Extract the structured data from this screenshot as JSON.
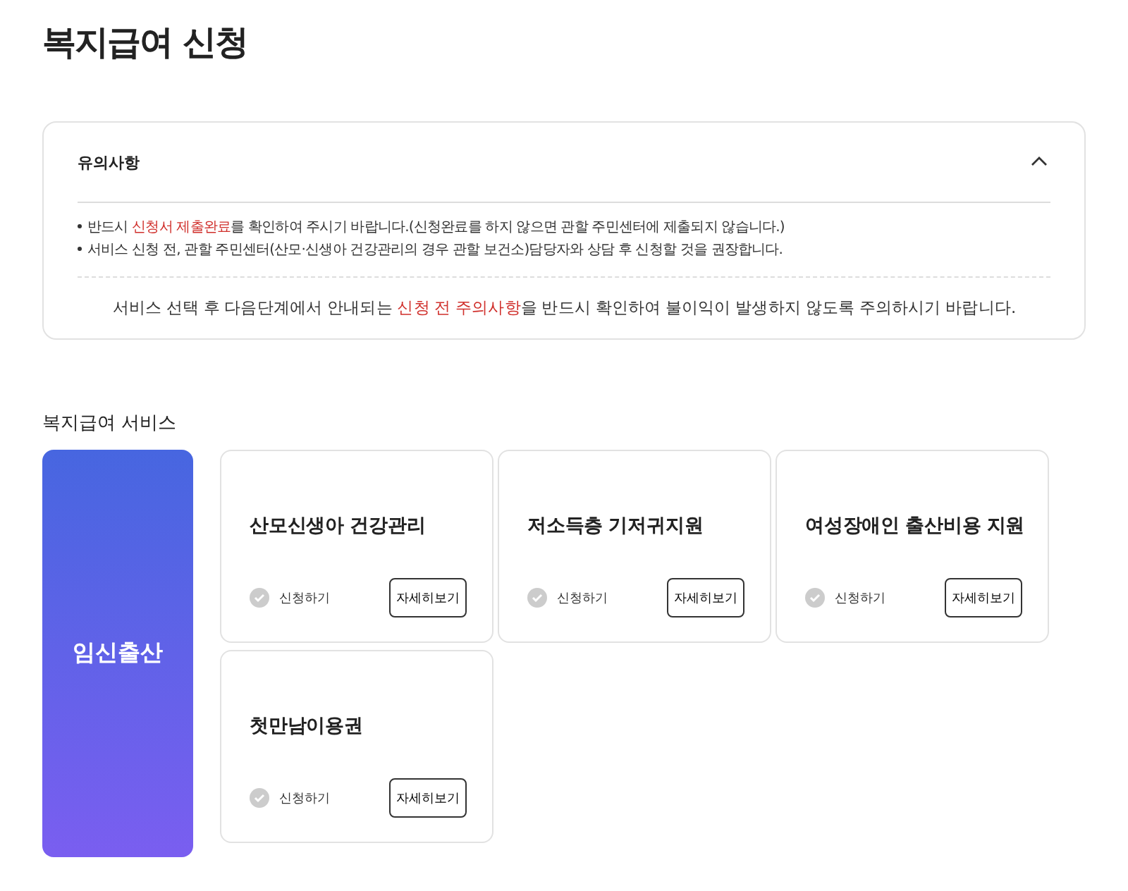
{
  "page_title": "복지급여 신청",
  "notice": {
    "title": "유의사항",
    "expanded": true,
    "bullets": [
      [
        {
          "text": "반드시 ",
          "highlight": false
        },
        {
          "text": "신청서 제출완료",
          "highlight": true
        },
        {
          "text": "를 확인하여 주시기 바랍니다.(신청완료를 하지 않으면 관할 주민센터에 제출되지 않습니다.)",
          "highlight": false
        }
      ],
      [
        {
          "text": "서비스 신청 전, 관할 주민센터(산모·신생아 건강관리의 경우 관할 보건소)담당자와 상담 후 신청할 것을 권장합니다.",
          "highlight": false
        }
      ]
    ],
    "footer": [
      {
        "text": "서비스 선택 후 다음단계에서 안내되는 ",
        "highlight": false
      },
      {
        "text": "신청 전 주의사항",
        "highlight": true
      },
      {
        "text": "을 반드시 확인하여 불이익이 발생하지 않도록 주의하시기 바랍니다.",
        "highlight": false
      }
    ]
  },
  "section_title": "복지급여 서비스",
  "category": {
    "label": "임신출산",
    "selected": true
  },
  "services": [
    {
      "name": "산모신생아 건강관리",
      "apply_label": "신청하기",
      "checked": false,
      "detail_button": "자세히보기"
    },
    {
      "name": "저소득층 기저귀지원",
      "apply_label": "신청하기",
      "checked": false,
      "detail_button": "자세히보기"
    },
    {
      "name": "여성장애인 출산비용 지원",
      "apply_label": "신청하기",
      "checked": false,
      "detail_button": "자세히보기"
    },
    {
      "name": "첫만남이용권",
      "apply_label": "신청하기",
      "checked": false,
      "detail_button": "자세히보기"
    }
  ]
}
